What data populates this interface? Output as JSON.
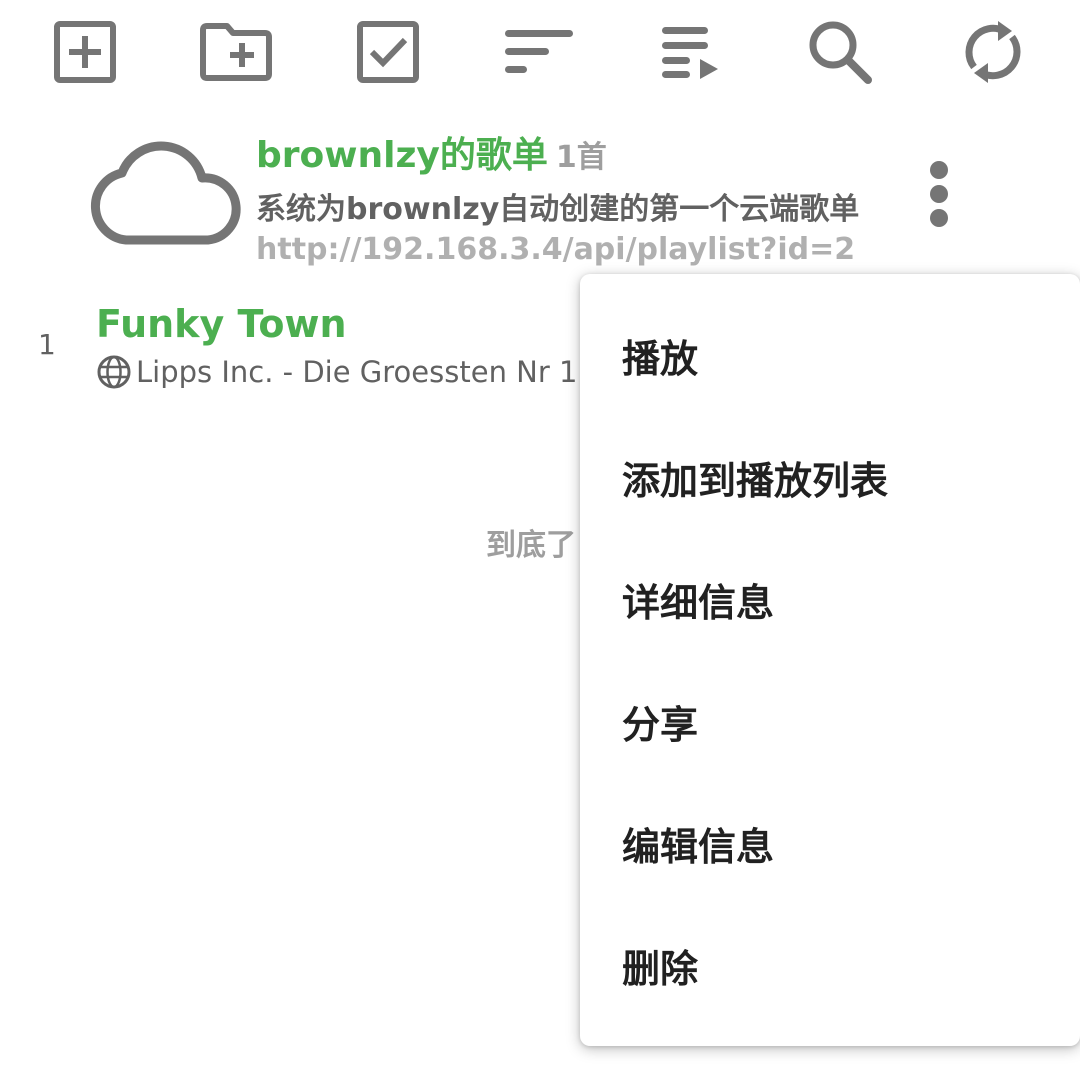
{
  "toolbar": {
    "buttons": [
      {
        "icon": "add-box-icon"
      },
      {
        "icon": "new-folder-icon"
      },
      {
        "icon": "checkbox-icon"
      },
      {
        "icon": "sort-icon"
      },
      {
        "icon": "play-queue-icon"
      },
      {
        "icon": "search-icon"
      },
      {
        "icon": "refresh-icon"
      }
    ],
    "icon_color": "#757575"
  },
  "playlist": {
    "name": "brownlzy的歌单",
    "count": "1首",
    "description": "系统为brownlzy自动创建的第一个云端歌单",
    "url": "http://192.168.3.4/api/playlist?id=2",
    "icon": "cloud-icon"
  },
  "songs": [
    {
      "index": "1",
      "title": "Funky Town",
      "subtitle": "Lipps Inc. - Die Groessten Nr 1",
      "source_icon": "globe-icon"
    }
  ],
  "list_end_text": "到底了",
  "menu": {
    "items": [
      {
        "label": "播放"
      },
      {
        "label": "添加到播放列表"
      },
      {
        "label": "详细信息"
      },
      {
        "label": "分享"
      },
      {
        "label": "编辑信息"
      },
      {
        "label": "删除"
      }
    ]
  },
  "colors": {
    "accent": "#4CAF50",
    "icon_gray": "#757575",
    "text_secondary": "#616161",
    "text_hint": "#9e9e9e"
  }
}
